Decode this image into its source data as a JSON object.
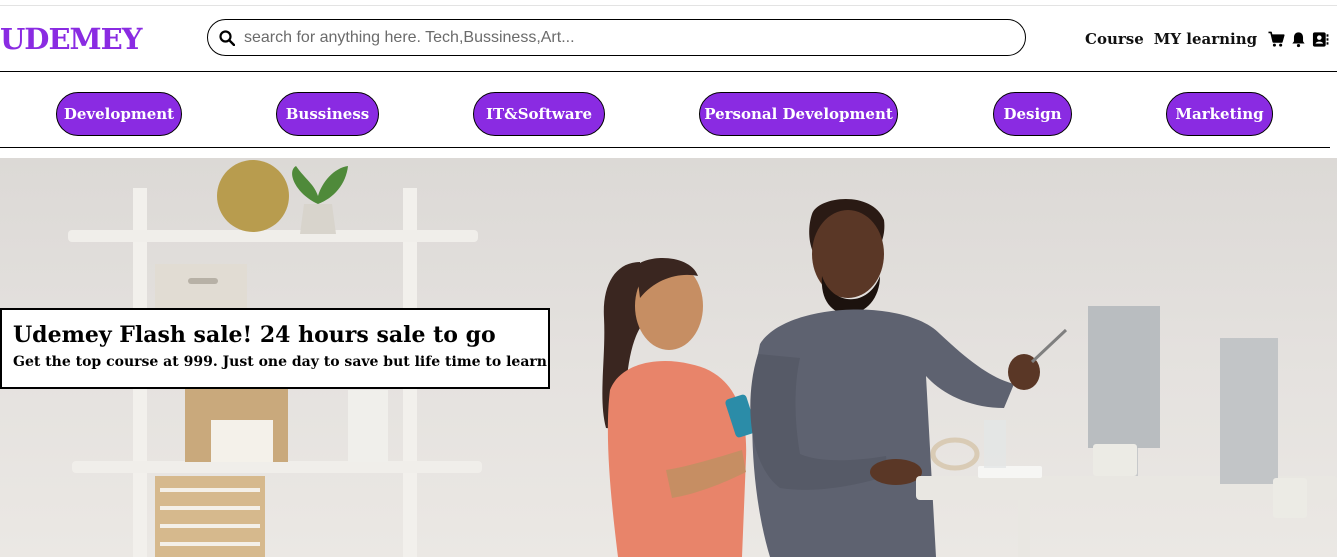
{
  "header": {
    "logo": "UDEMEY",
    "search": {
      "placeholder": "search for anything here. Tech,Bussiness,Art...",
      "value": ""
    },
    "nav": {
      "course": "Course",
      "my_learning": "MY learning"
    },
    "icons": [
      "search-icon",
      "cart-icon",
      "bell-icon",
      "profile-card-icon"
    ]
  },
  "categories": [
    {
      "label": "Development"
    },
    {
      "label": "Bussiness"
    },
    {
      "label": "IT&Software"
    },
    {
      "label": "Personal Development"
    },
    {
      "label": "Design"
    },
    {
      "label": "Marketing"
    }
  ],
  "hero": {
    "banner_title": "Udemey Flash sale! 24 hours sale to go",
    "banner_subtitle": "Get the top course at 999. Just one day to save but life time to learn"
  },
  "colors": {
    "brand": "#8a2be2",
    "text": "#111111",
    "background": "#ffffff"
  }
}
